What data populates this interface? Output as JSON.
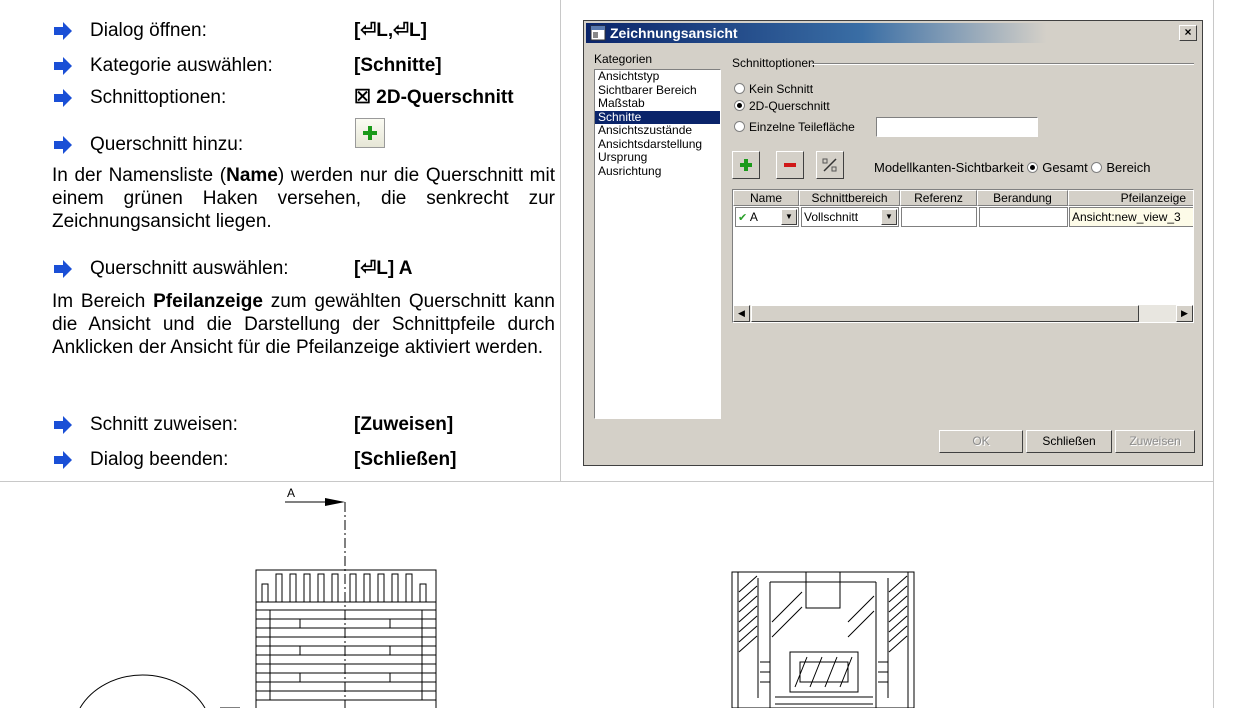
{
  "steps_top": [
    {
      "label": "Dialog öffnen:",
      "value": "[⏎L,⏎L]"
    },
    {
      "label": "Kategorie auswählen:",
      "value": "[Schnitte]"
    },
    {
      "label": "Schnittoptionen:",
      "value": "☒ 2D-Querschnitt"
    },
    {
      "label": "Querschnitt hinzu:",
      "value": ""
    }
  ],
  "para1": {
    "pre": "In der Namensliste (",
    "bold": "Name",
    "post": ") werden nur die Quer­schnitt mit einem grünen Haken versehen, die senkrecht zur Zeichnungsansicht liegen."
  },
  "step_select": {
    "label": "Querschnitt auswählen:",
    "value": "[⏎L] A"
  },
  "para2": {
    "pre": "Im Bereich ",
    "bold": "Pfeilanzeige",
    "post": " zum gewählten Quer­schnitt kann die Ansicht und die Darstellung der Schnittpfeile durch Anklicken der Ansicht für die Pfeilanzeige aktiviert werden."
  },
  "steps_bottom": [
    {
      "label": "Schnitt zuweisen:",
      "value": "[Zuweisen]"
    },
    {
      "label": "Dialog beenden:",
      "value": "[Schließen]"
    }
  ],
  "dialog": {
    "title": "Zeichnungsansicht",
    "close_glyph": "×",
    "categories_title": "Kategorien",
    "categories": [
      "Ansichtstyp",
      "Sichtbarer Bereich",
      "Maßstab",
      "Schnitte",
      "Ansichtszustände",
      "Ansichtsdarstellung",
      "Ursprung",
      "Ausrichtung"
    ],
    "selected_category": "Schnitte",
    "section_group_label": "Schnittoptionen",
    "options": [
      {
        "label": "Kein Schnitt",
        "selected": false
      },
      {
        "label": "2D-Querschnitt",
        "selected": true
      },
      {
        "label": "Einzelne Teilefläche",
        "selected": false
      }
    ],
    "teilflaeche_value": "",
    "visibility_label": "Modellkanten-Sichtbarkeit",
    "visibility_options": [
      {
        "label": "Gesamt",
        "selected": true
      },
      {
        "label": "Bereich",
        "selected": false
      }
    ],
    "columns": [
      "Name",
      "Schnittbereich",
      "Referenz",
      "Berandung",
      "Pfeilanzeige"
    ],
    "row": {
      "name": "A",
      "bereich": "Vollschnitt",
      "referenz": "",
      "berandung": "",
      "pfeilanzeige": "Ansicht:new_view_3"
    },
    "buttons": {
      "ok": "OK",
      "close": "Schließen",
      "assign": "Zuweisen"
    }
  },
  "drawing": {
    "section_label": "A"
  },
  "colors": {
    "arrow_blue": "#1a4fd6",
    "plus_green": "#1a9a1a",
    "minus_red": "#d01818",
    "check_green": "#2aa02a",
    "pfeil_cell_bg": "#fdfbe8"
  }
}
